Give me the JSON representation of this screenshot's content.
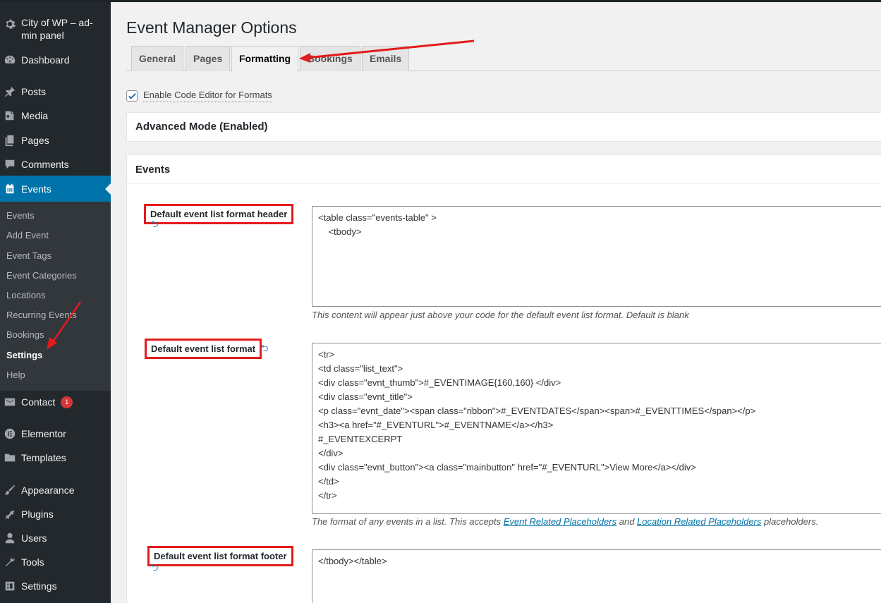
{
  "sidebar": {
    "site_title": "City of WP – ad-min panel",
    "items": [
      {
        "label": "Dashboard",
        "icon": "dashboard-icon"
      },
      {
        "label": "Posts",
        "icon": "pin-icon"
      },
      {
        "label": "Media",
        "icon": "media-icon"
      },
      {
        "label": "Pages",
        "icon": "pages-icon"
      },
      {
        "label": "Comments",
        "icon": "comment-icon"
      },
      {
        "label": "Events",
        "icon": "calendar-icon"
      },
      {
        "label": "Contact",
        "icon": "mail-icon",
        "badge": "1"
      },
      {
        "label": "Elementor",
        "icon": "elementor-icon"
      },
      {
        "label": "Templates",
        "icon": "folder-icon"
      },
      {
        "label": "Appearance",
        "icon": "brush-icon"
      },
      {
        "label": "Plugins",
        "icon": "plugin-icon"
      },
      {
        "label": "Users",
        "icon": "user-icon"
      },
      {
        "label": "Tools",
        "icon": "wrench-icon"
      },
      {
        "label": "Settings",
        "icon": "settings-icon"
      }
    ],
    "submenu": [
      "Events",
      "Add Event",
      "Event Tags",
      "Event Categories",
      "Locations",
      "Recurring Events",
      "Bookings",
      "Settings",
      "Help"
    ]
  },
  "page": {
    "title": "Event Manager Options",
    "tabs": [
      "General",
      "Pages",
      "Formatting",
      "Bookings",
      "Emails"
    ],
    "active_tab": "Formatting",
    "code_editor_label": "Enable Code Editor for Formats",
    "advanced_mode": "Advanced Mode (Enabled)",
    "events_section": "Events"
  },
  "fields": {
    "header_label": "Default event list format header",
    "header_code": [
      "<table class=\"events-table\" >",
      "    <tbody>"
    ],
    "header_desc": "This content will appear just above your code for the default event list format. Default is blank",
    "format_label": "Default event list format",
    "format_code": [
      "<tr>",
      "<td class=\"list_text\">",
      "<div class=\"evnt_thumb\">#_EVENTIMAGE{160,160} </div>",
      "<div class=\"evnt_title\">",
      "<p class=\"evnt_date\"><span class=\"ribbon\">#_EVENTDATES</span><span>#_EVENTTIMES</span></p>",
      "<h3><a href=\"#_EVENTURL\">#_EVENTNAME</a></h3>",
      "#_EVENTEXCERPT",
      "</div>",
      "<div class=\"evnt_button\"><a class=\"mainbutton\" href=\"#_EVENTURL\">View More</a></div>",
      "</td>",
      "</tr>"
    ],
    "format_desc_pre": "The format of any events in a list. This accepts ",
    "format_desc_link1": "Event Related Placeholders",
    "format_desc_mid": " and ",
    "format_desc_link2": "Location Related Placeholders",
    "format_desc_post": " placeholders.",
    "footer_label": "Default event list format footer",
    "footer_code": [
      "</tbody></table>"
    ]
  },
  "colors": {
    "sidebar": "#23282d",
    "active": "#0073aa",
    "highlight": "#e31b1b"
  }
}
